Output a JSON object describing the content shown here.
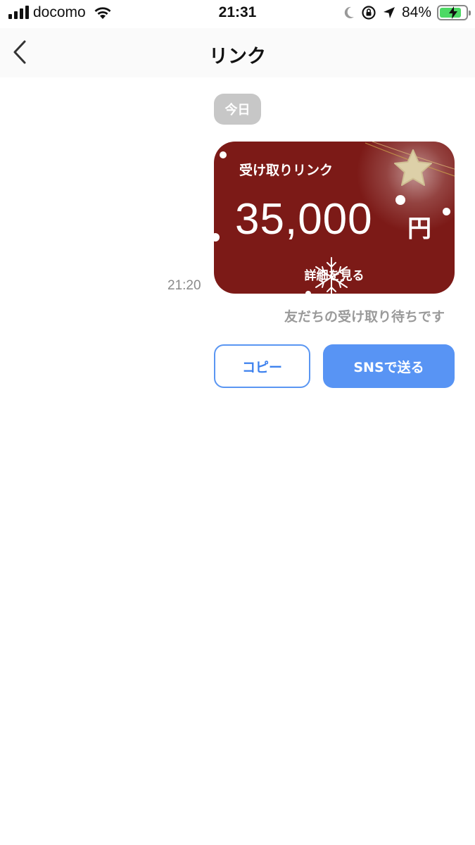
{
  "status_bar": {
    "carrier": "docomo",
    "time": "21:31",
    "battery_percent": "84%",
    "battery_level": 0.84,
    "icons": [
      "signal-icon",
      "wifi-icon",
      "moon-icon",
      "rotation-lock-icon",
      "location-icon",
      "battery-icon"
    ]
  },
  "nav": {
    "title": "リンク",
    "back_icon": "chevron-left-icon"
  },
  "chat": {
    "date_label": "今日",
    "message_time": "21:20",
    "card": {
      "label": "受け取りリンク",
      "amount": "35,000",
      "currency": "円",
      "details_link": "詳細を見る",
      "background_color": "#7c1a17"
    },
    "status_text": "友だちの受け取り待ちです"
  },
  "actions": {
    "copy_label": "コピー",
    "sns_label": "SNSで送る",
    "accent_color": "#5894f4"
  }
}
